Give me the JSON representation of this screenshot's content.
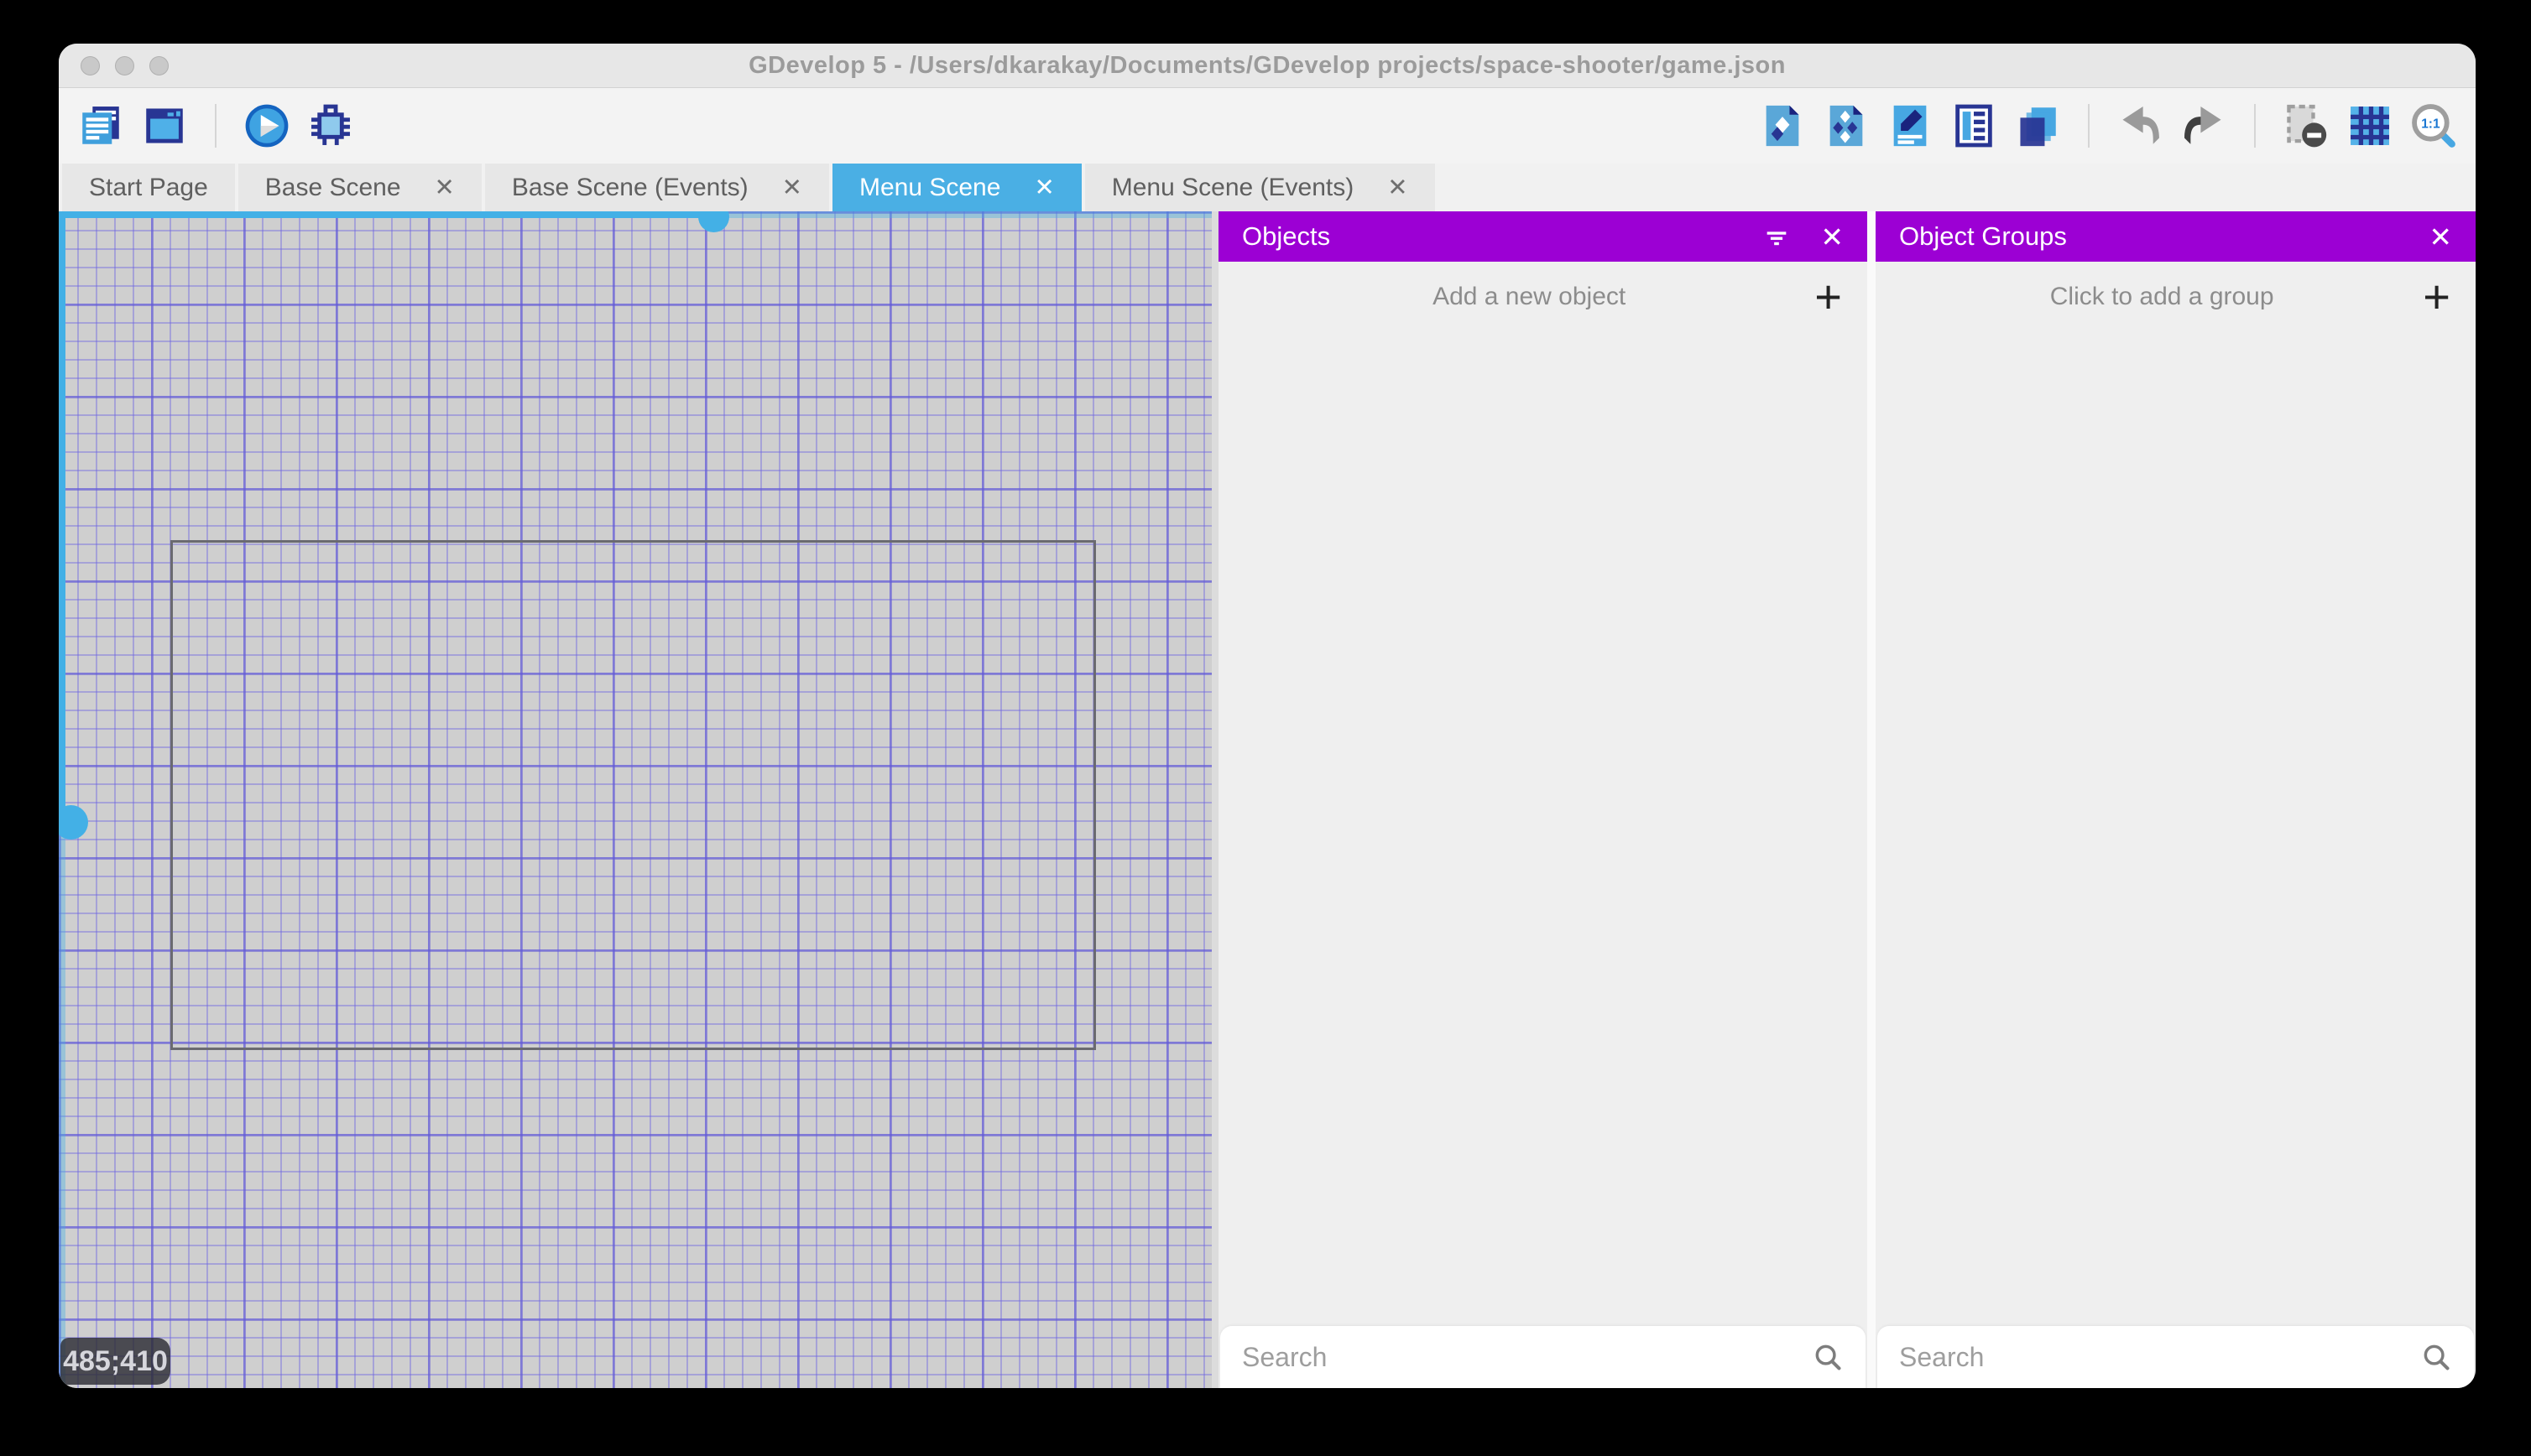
{
  "window": {
    "title": "GDevelop 5 - /Users/dkarakay/Documents/GDevelop projects/space-shooter/game.json"
  },
  "toolbar": {
    "left_icons": [
      "project-manager",
      "scene-window",
      "preview-play",
      "debug"
    ],
    "right_icons": [
      "objects-panel",
      "object-groups-panel",
      "properties-panel",
      "instances-list-panel",
      "layers-panel",
      "undo",
      "redo",
      "hide-instances",
      "toggle-grid",
      "zoom-1-1"
    ],
    "zoom_label": "1:1"
  },
  "tabbar": {
    "tabs": [
      {
        "label": "Start Page",
        "closable": false,
        "active": false
      },
      {
        "label": "Base Scene",
        "closable": true,
        "active": false
      },
      {
        "label": "Base Scene (Events)",
        "closable": true,
        "active": false
      },
      {
        "label": "Menu Scene",
        "closable": true,
        "active": true
      },
      {
        "label": "Menu Scene (Events)",
        "closable": true,
        "active": false
      }
    ]
  },
  "canvas": {
    "coordinates": "485;410"
  },
  "objects_panel": {
    "title": "Objects",
    "add_label": "Add a new object",
    "search_placeholder": "Search"
  },
  "groups_panel": {
    "title": "Object Groups",
    "add_label": "Click to add a group",
    "search_placeholder": "Search"
  },
  "ui": {
    "close_glyph": "✕",
    "plus_glyph": "+"
  },
  "colors": {
    "panel_header_purple": "#9c00d4",
    "active_tab_blue": "#4aafe4",
    "scrollbar_blue": "#43b0e6",
    "canvas_bg": "#cfcfcf",
    "grid_line": "#726ae0",
    "titlebar_bg": "#e7e7e7",
    "panel_bg": "#efefef"
  }
}
